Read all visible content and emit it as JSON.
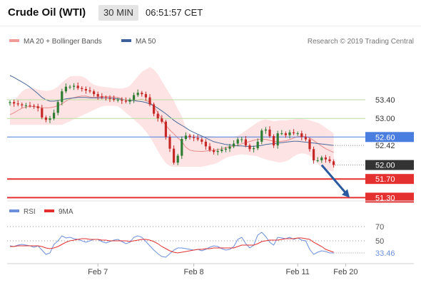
{
  "header": {
    "title": "Crude Oil (WTI)",
    "timeframe": "30 MIN",
    "time": "06:51:57 CET"
  },
  "legend": {
    "bb_label": "MA 20 + Bollinger Bands",
    "ma50_label": "MA 50",
    "research": "Research © 2019 Trading Central"
  },
  "rsi_legend": {
    "rsi_label": "RSI",
    "ma_label": "9MA"
  },
  "colors": {
    "bands": "#fde3e3",
    "ma20": "#e88a8a",
    "ma50": "#4a6a9a",
    "bull": "#2e7d32",
    "bear": "#c62828",
    "green_level": "#b9dc9f",
    "blue_level": "#4a7de0",
    "red_level": "#e53030",
    "rsi": "#6b8fdc",
    "rsi_ma": "#e23030",
    "current": "#333333"
  },
  "chart_data": [
    {
      "type": "candlestick",
      "title": "Crude Oil (WTI)",
      "timeframe": "30 MIN",
      "x_ticks": [
        {
          "label": "Feb 7",
          "index": 22
        },
        {
          "label": "Feb 8",
          "index": 46
        },
        {
          "label": "Feb 11",
          "index": 72
        },
        {
          "label": "Feb 20",
          "index": 84
        }
      ],
      "ylim": [
        51.26,
        54.47
      ],
      "last_price": 52.0,
      "levels": [
        {
          "value": 53.4,
          "label": "53.40",
          "kind": "resistance"
        },
        {
          "value": 53.0,
          "label": "53.00",
          "kind": "resistance"
        },
        {
          "value": 52.6,
          "label": "52.60",
          "kind": "pivot"
        },
        {
          "value": 52.42,
          "label": "52.42",
          "kind": "marker"
        },
        {
          "value": 52.0,
          "label": "52.00",
          "kind": "current"
        },
        {
          "value": 51.7,
          "label": "51.70",
          "kind": "target"
        },
        {
          "value": 51.3,
          "label": "51.30",
          "kind": "target"
        }
      ],
      "projection": {
        "from_index": 78,
        "from": 52.0,
        "to_index": 85,
        "to": 51.3
      },
      "close": [
        53.35,
        53.32,
        53.3,
        53.28,
        53.28,
        53.27,
        53.26,
        53.22,
        53.02,
        52.97,
        53.0,
        53.12,
        53.35,
        53.58,
        53.68,
        53.68,
        53.7,
        53.65,
        53.63,
        53.6,
        53.58,
        53.52,
        53.47,
        53.45,
        53.44,
        53.42,
        53.4,
        53.4,
        53.38,
        53.36,
        53.4,
        53.5,
        53.55,
        53.52,
        53.45,
        53.3,
        53.1,
        53.0,
        52.93,
        52.6,
        52.35,
        52.05,
        52.2,
        52.56,
        52.63,
        52.6,
        52.58,
        52.55,
        52.5,
        52.4,
        52.32,
        52.28,
        52.3,
        52.33,
        52.35,
        52.4,
        52.46,
        52.55,
        52.55,
        52.42,
        52.34,
        52.36,
        52.5,
        52.74,
        52.76,
        52.62,
        52.42,
        52.68,
        52.68,
        52.64,
        52.7,
        52.68,
        52.68,
        52.6,
        52.55,
        52.34,
        52.1,
        52.1,
        52.16,
        52.12,
        52.08,
        52.0
      ],
      "bollinger": {
        "upper": [
          53.3,
          53.38,
          53.48,
          53.58,
          53.63,
          53.65,
          53.65,
          53.62,
          53.6,
          53.59,
          53.6,
          53.63,
          53.68,
          53.77,
          53.84,
          53.9,
          53.91,
          53.91,
          53.9,
          53.86,
          53.78,
          53.72,
          53.7,
          53.68,
          53.67,
          53.66,
          53.65,
          53.64,
          53.64,
          53.66,
          53.7,
          53.8,
          53.9,
          54.0,
          54.05,
          54.1,
          54.05,
          53.95,
          53.8,
          53.66,
          53.52,
          53.38,
          53.2,
          53.05,
          52.8,
          52.68,
          52.64,
          52.63,
          52.62,
          52.62,
          52.62,
          52.61,
          52.6,
          52.6,
          52.6,
          52.6,
          52.6,
          52.63,
          52.68,
          52.74,
          52.8,
          52.86,
          52.92,
          52.96,
          52.98,
          52.96,
          52.94,
          52.95,
          52.96,
          52.96,
          52.97,
          52.98,
          52.99,
          52.99,
          52.98,
          52.96,
          52.93,
          52.91,
          52.86,
          52.8,
          52.74,
          52.68
        ],
        "lower": [
          52.86,
          52.86,
          52.86,
          52.86,
          52.86,
          52.86,
          52.86,
          52.86,
          52.86,
          52.86,
          52.86,
          52.86,
          52.86,
          52.86,
          52.9,
          52.94,
          52.98,
          53.02,
          53.06,
          53.1,
          53.14,
          53.18,
          53.22,
          53.26,
          53.27,
          53.27,
          53.27,
          53.26,
          53.2,
          53.12,
          53.05,
          52.98,
          52.9,
          52.82,
          52.72,
          52.6,
          52.46,
          52.3,
          52.16,
          52.04,
          51.98,
          51.96,
          51.96,
          51.96,
          51.96,
          51.96,
          51.96,
          51.96,
          51.96,
          51.98,
          52.0,
          52.02,
          52.05,
          52.1,
          52.15,
          52.18,
          52.2,
          52.22,
          52.23,
          52.22,
          52.21,
          52.2,
          52.18,
          52.15,
          52.12,
          52.1,
          52.08,
          52.06,
          52.06,
          52.08,
          52.12,
          52.18,
          52.23,
          52.25,
          52.24,
          52.2,
          52.12,
          52.02,
          51.95,
          51.9,
          51.88,
          51.86
        ]
      },
      "ma50": [
        53.92,
        53.88,
        53.83,
        53.78,
        53.73,
        53.67,
        53.6,
        53.53,
        53.45,
        53.4,
        53.37,
        53.37,
        53.38,
        53.4,
        53.42,
        53.43,
        53.44,
        53.45,
        53.45,
        53.45,
        53.44,
        53.44,
        53.44,
        53.44,
        53.44,
        53.44,
        53.43,
        53.42,
        53.41,
        53.4,
        53.39,
        53.38,
        53.37,
        53.36,
        53.34,
        53.31,
        53.27,
        53.22,
        53.16,
        53.1,
        53.03,
        52.96,
        52.9,
        52.85,
        52.8,
        52.74,
        52.7,
        52.66,
        52.62,
        52.58,
        52.54,
        52.5,
        52.48,
        52.46,
        52.44,
        52.43,
        52.42,
        52.41,
        52.41,
        52.4,
        52.4,
        52.4,
        52.41,
        52.42,
        52.44,
        52.45,
        52.46,
        52.47,
        52.48,
        52.49,
        52.5,
        52.51,
        52.51,
        52.5,
        52.49,
        52.48,
        52.47,
        52.46,
        52.45,
        52.44,
        52.43,
        52.42
      ]
    },
    {
      "type": "line",
      "title": "RSI",
      "ylim": [
        20,
        78
      ],
      "yticks": [
        70,
        50
      ],
      "current_label": "33.46",
      "series": [
        {
          "name": "RSI",
          "values": [
            43,
            42,
            44,
            45,
            44,
            43,
            41,
            43,
            37,
            31,
            33,
            45,
            50,
            57,
            54,
            55,
            53,
            52,
            50,
            48,
            50,
            52,
            52,
            49,
            47,
            49,
            51,
            52,
            49,
            46,
            48,
            55,
            57,
            55,
            49,
            43,
            37,
            32,
            28,
            27,
            32,
            37,
            40,
            40,
            39,
            38,
            37,
            38,
            36,
            38,
            41,
            43,
            42,
            39,
            37,
            38,
            42,
            52,
            55,
            46,
            40,
            44,
            58,
            62,
            56,
            48,
            44,
            55,
            54,
            53,
            55,
            52,
            54,
            51,
            50,
            38,
            31,
            34,
            36,
            35,
            33,
            33
          ]
        },
        {
          "name": "9MA",
          "values": [
            42,
            42,
            43,
            43,
            43,
            43,
            43,
            43,
            42,
            40,
            39,
            40,
            42,
            45,
            48,
            50,
            51,
            52,
            53,
            53,
            52,
            52,
            52,
            51,
            51,
            50,
            50,
            50,
            50,
            50,
            49,
            50,
            51,
            52,
            52,
            51,
            49,
            46,
            42,
            39,
            36,
            34,
            33,
            34,
            35,
            36,
            37,
            38,
            38,
            39,
            39,
            40,
            40,
            40,
            40,
            40,
            40,
            42,
            44,
            44,
            44,
            44,
            46,
            49,
            50,
            51,
            51,
            51,
            52,
            53,
            53,
            53,
            54,
            54,
            53,
            52,
            48,
            45,
            42,
            38,
            36,
            34
          ]
        }
      ]
    }
  ]
}
